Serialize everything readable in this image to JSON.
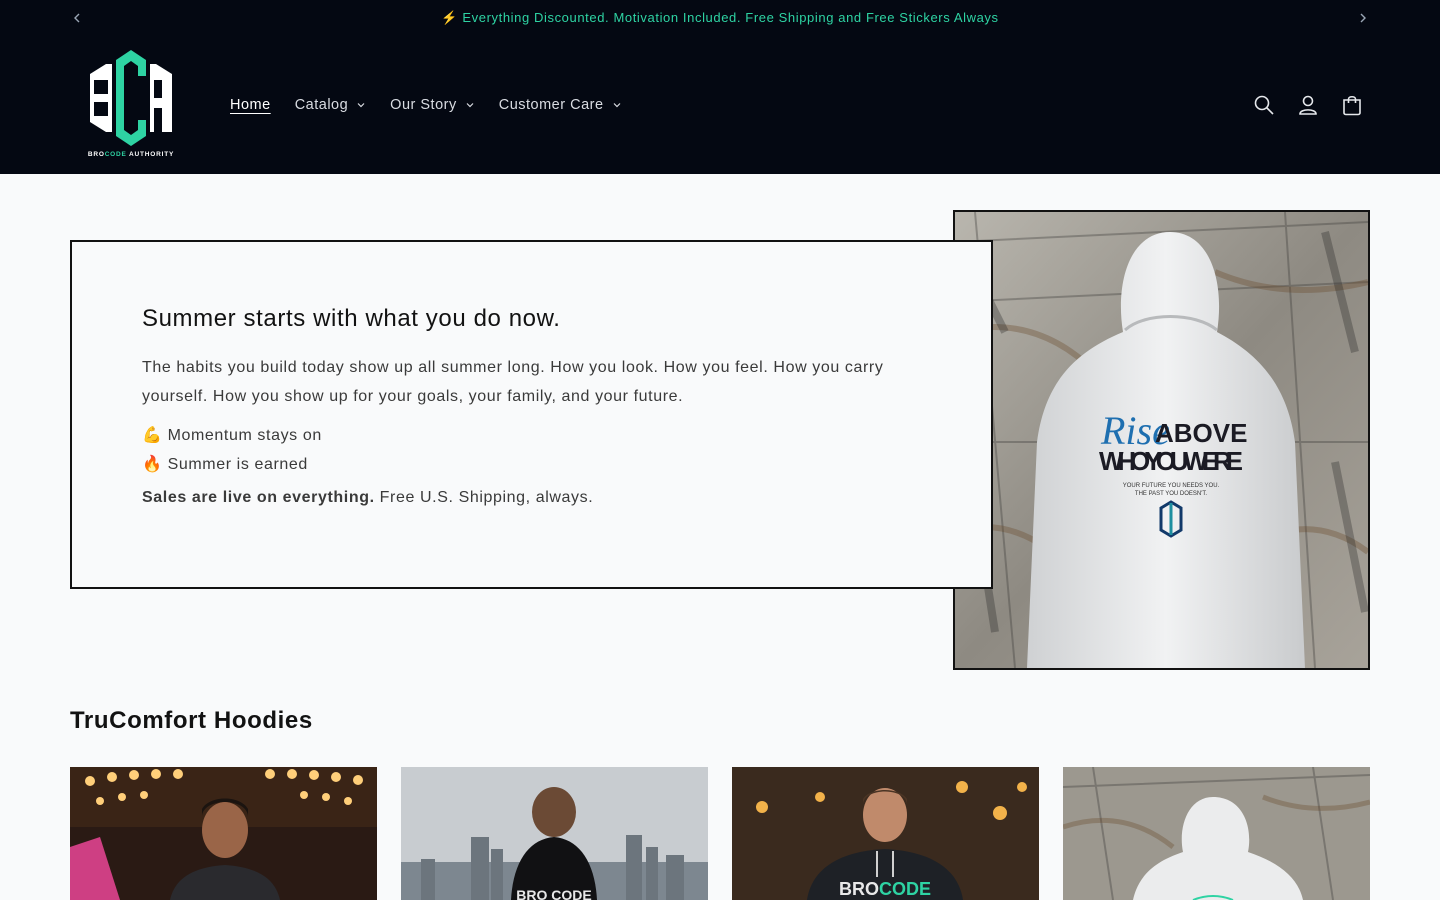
{
  "announcement": {
    "text": "⚡ Everything Discounted. Motivation Included. Free Shipping and Free Stickers Always",
    "prev_icon": "chevron-left-icon",
    "next_icon": "chevron-right-icon"
  },
  "header": {
    "logo": {
      "letters": "BCA",
      "subtitle_pre": "BRO",
      "subtitle_accent": "CODE",
      "subtitle_post": " AUTHORITY"
    },
    "nav": [
      {
        "label": "Home",
        "active": true,
        "has_dropdown": false
      },
      {
        "label": "Catalog",
        "active": false,
        "has_dropdown": true
      },
      {
        "label": "Our Story",
        "active": false,
        "has_dropdown": true
      },
      {
        "label": "Customer Care",
        "active": false,
        "has_dropdown": true
      }
    ],
    "icons": [
      "search-icon",
      "account-icon",
      "cart-icon"
    ]
  },
  "hero": {
    "heading": "Summer starts with what you do now.",
    "body": "The habits you build today show up all summer long. How you look. How you feel. How you carry yourself. How you show up for your goals, your family, and your future.",
    "list": [
      "💪 Momentum stays on",
      "🔥 Summer is earned"
    ],
    "cta_bold": "Sales are live on everything.",
    "cta_rest": " Free U.S. Shipping, always.",
    "image": {
      "print_script": "Rise",
      "print_line1": "ABOVE",
      "print_line2": "WHO YOU WERE",
      "print_small1": "YOUR FUTURE YOU NEEDS YOU.",
      "print_small2": "THE PAST YOU DOESN'T."
    }
  },
  "collection": {
    "title": "TruComfort Hoodies",
    "cards": [
      {
        "alt": "Man in black hoodie under marquee lights"
      },
      {
        "alt": "Back of black hoodie facing city skyline",
        "print_text": "BRO CODE"
      },
      {
        "alt": "Man in black hoodie in cafe",
        "print_pre": "BRO",
        "print_accent": "CODE"
      },
      {
        "alt": "Back of white hoodie against painted wall"
      }
    ]
  },
  "colors": {
    "header_bg": "#040812",
    "accent": "#2ed3a3",
    "page_bg": "#f9fafb",
    "text": "#121212"
  }
}
